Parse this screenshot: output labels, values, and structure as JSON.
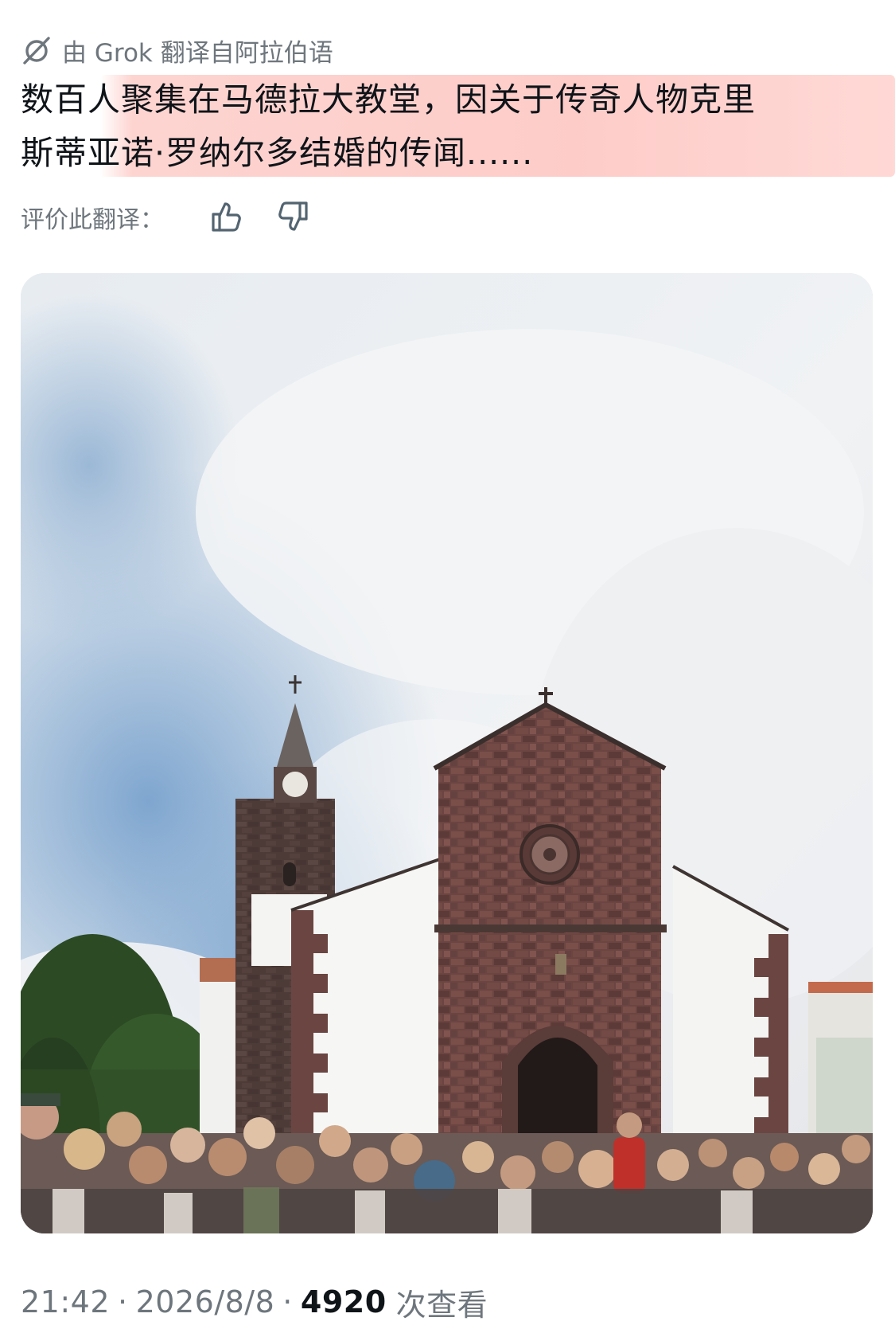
{
  "translation": {
    "label": "由 Grok 翻译自阿拉伯语",
    "icon": "grok-icon"
  },
  "tweet": {
    "text_line1": "数百人聚集在马德拉大教堂，因关于传奇人物克里",
    "text_line2": "斯蒂亚诺·罗纳尔多结婚的传闻......",
    "highlight_color": "#fdcdc8"
  },
  "rating": {
    "label": "评价此翻译：",
    "thumbs_up_icon": "thumbs-up-icon",
    "thumbs_down_icon": "thumbs-down-icon"
  },
  "media": {
    "kind": "photo",
    "subject": "cathedral"
  },
  "meta": {
    "time": "21:42",
    "date": "2026/8/8",
    "separator": "·",
    "views_count": "4920",
    "views_label": "次查看"
  }
}
